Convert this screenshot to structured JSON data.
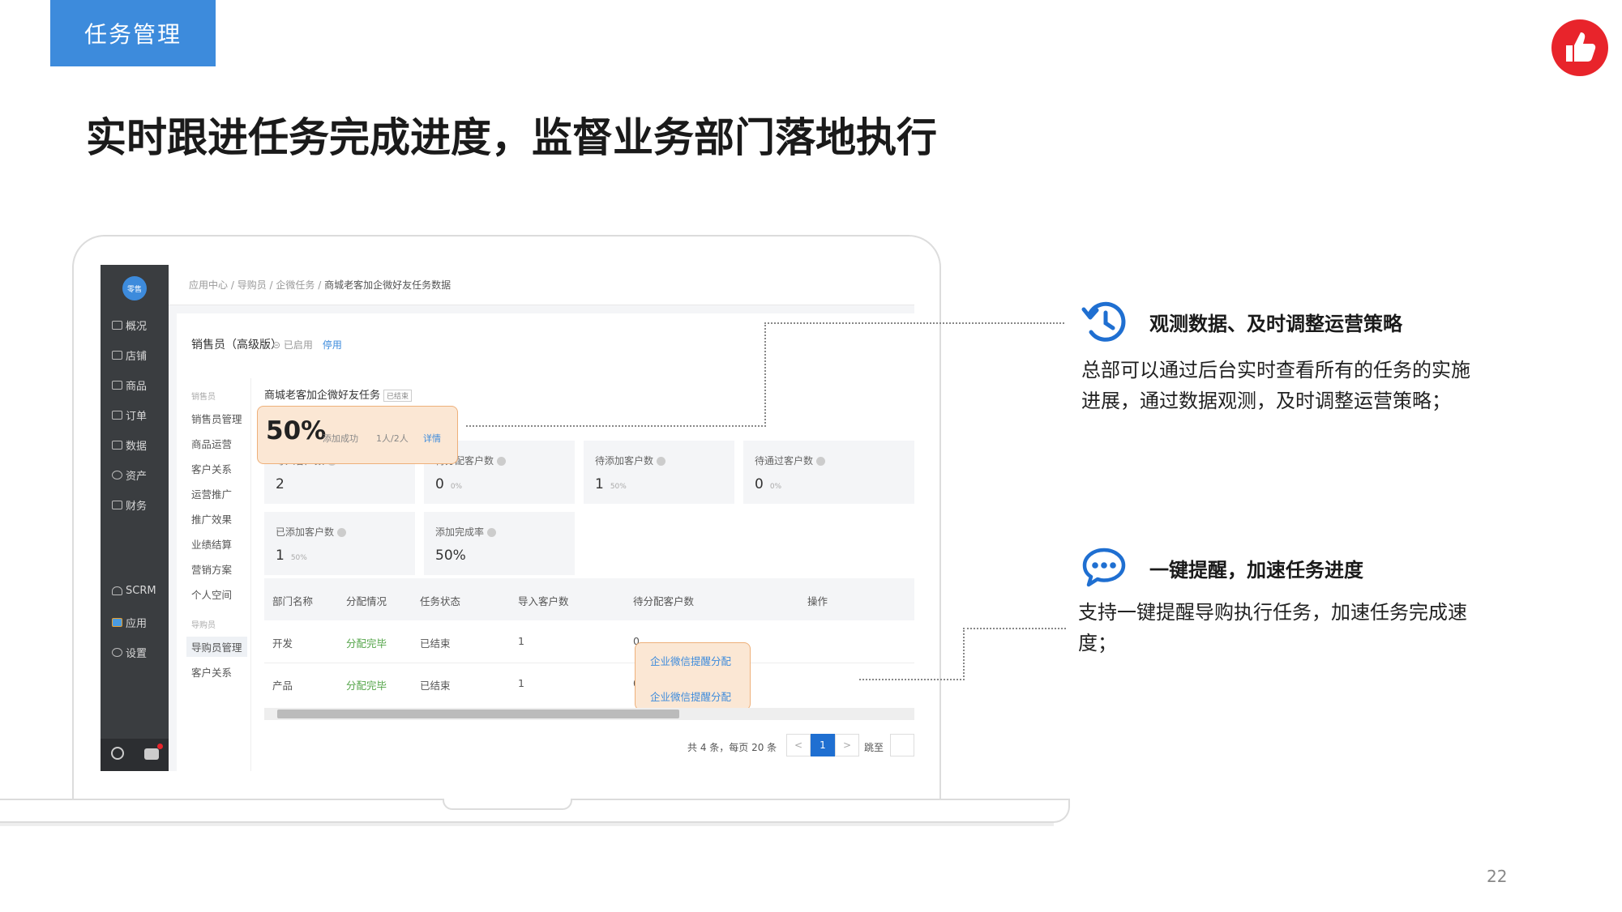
{
  "slide": {
    "tag": "任务管理",
    "headline": "实时跟进任务完成进度，监督业务部门落地执行",
    "page_number": "22",
    "brand_color": "#e8242b",
    "accent_color": "#3d8bdc"
  },
  "app": {
    "avatar_text": "零售",
    "sidebar": [
      {
        "label": "概况",
        "icon": "monitor-icon"
      },
      {
        "label": "店铺",
        "icon": "store-icon"
      },
      {
        "label": "商品",
        "icon": "tag-icon"
      },
      {
        "label": "订单",
        "icon": "list-icon"
      },
      {
        "label": "数据",
        "icon": "bar-chart-icon"
      },
      {
        "label": "资产",
        "icon": "target-icon"
      },
      {
        "label": "财务",
        "icon": "wallet-icon"
      },
      {
        "label": "SCRM",
        "icon": "user-icon"
      },
      {
        "label": "应用",
        "icon": "apps-icon"
      },
      {
        "label": "设置",
        "icon": "gear-icon"
      }
    ],
    "breadcrumb": [
      "应用中心",
      "导购员",
      "企微任务",
      "商城老客加企微好友任务数据"
    ],
    "panel_title": "销售员（高级版）",
    "status_enabled": "已启用",
    "status_stop": "停用",
    "subnav": {
      "group1": "销售员",
      "items1": [
        "销售员管理",
        "商品运营",
        "客户关系",
        "运营推广",
        "推广效果",
        "业绩结算",
        "营销方案",
        "个人空间"
      ],
      "group2": "导购员",
      "items2": [
        "导购员管理",
        "客户关系"
      ]
    },
    "task_name": "商城老客加企微好友任务",
    "task_badge": "已结束",
    "highlight": {
      "percent": "50%",
      "label": "添加成功",
      "count": "1人/2人",
      "detail": "详情"
    },
    "cards": [
      {
        "title": "导入客户数",
        "value": "2",
        "sub": ""
      },
      {
        "title": "待分配客户数",
        "value": "0",
        "sub": "0%"
      },
      {
        "title": "待添加客户数",
        "value": "1",
        "sub": "50%"
      },
      {
        "title": "待通过客户数",
        "value": "0",
        "sub": "0%"
      },
      {
        "title": "已添加客户数",
        "value": "1",
        "sub": "50%"
      },
      {
        "title": "添加完成率",
        "value": "50%",
        "sub": ""
      }
    ],
    "table": {
      "headers": [
        "部门名称",
        "分配情况",
        "任务状态",
        "导入客户数",
        "待分配客户数",
        "操作"
      ],
      "rows": [
        {
          "dept": "开发",
          "alloc": "分配完毕",
          "status": "已结束",
          "imported": "1",
          "pending": "0",
          "action": "企业微信提醒分配"
        },
        {
          "dept": "产品",
          "alloc": "分配完毕",
          "status": "已结束",
          "imported": "1",
          "pending": "0",
          "action": "企业微信提醒分配"
        }
      ]
    },
    "pager": {
      "summary": "共 4 条，每页 20 条",
      "prev": "<",
      "page": "1",
      "next": ">",
      "jump": "跳至"
    }
  },
  "callouts": [
    {
      "icon": "history-clock-icon",
      "title": "观测数据、及时调整运营策略",
      "body": "总部可以通过后台实时查看所有的任务的实施进展，通过数据观测，及时调整运营策略；"
    },
    {
      "icon": "chat-bubble-icon",
      "title": "一键提醒，加速任务进度",
      "body": "支持一键提醒导购执行任务，加速任务完成速度；"
    }
  ]
}
